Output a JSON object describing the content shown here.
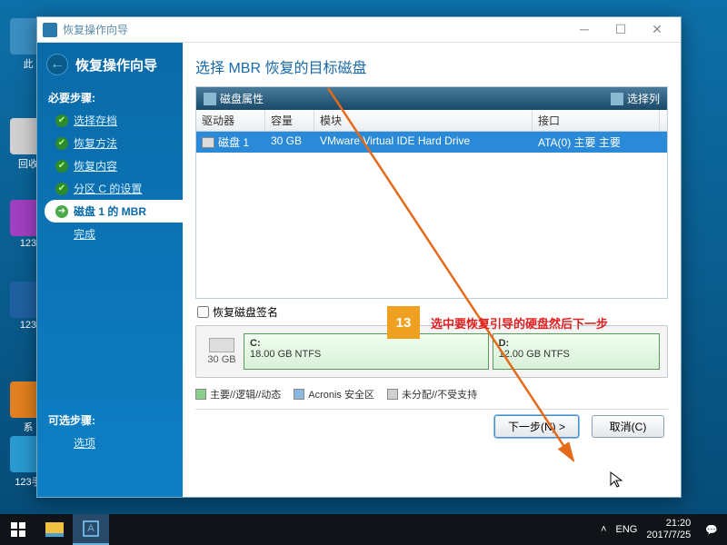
{
  "desktop": {
    "icons": [
      {
        "label": "此"
      },
      {
        "label": "回收"
      },
      {
        "label": "123"
      },
      {
        "label": "123"
      },
      {
        "label": "系"
      },
      {
        "label": "123手"
      }
    ]
  },
  "window": {
    "title": "恢复操作向导",
    "header": "恢复操作向导",
    "sidebar": {
      "required_title": "必要步骤:",
      "optional_title": "可选步骤:",
      "steps": [
        {
          "label": "选择存档",
          "state": "done"
        },
        {
          "label": "恢复方法",
          "state": "done"
        },
        {
          "label": "恢复内容",
          "state": "done"
        },
        {
          "label": "分区 C  的设置",
          "state": "done"
        },
        {
          "label": "磁盘 1 的 MBR",
          "state": "current"
        },
        {
          "label": "完成",
          "state": ""
        }
      ],
      "optional": [
        {
          "label": "选项"
        }
      ]
    },
    "main": {
      "title": "选择 MBR 恢复的目标磁盘",
      "toolbar": {
        "props_label": "磁盘属性",
        "cols_label": "选择列"
      },
      "columns": {
        "drive": "驱动器",
        "capacity": "容量",
        "module": "模块",
        "interface": "接口"
      },
      "row": {
        "drive": "磁盘 1",
        "capacity": "30 GB",
        "module": "VMware Virtual IDE Hard Drive",
        "interface": "ATA(0) 主要 主要"
      },
      "recover_sig_label": "恢复磁盘签名",
      "diskmap": {
        "total": "30 GB",
        "parts": [
          {
            "name": "C:",
            "detail": "18.00 GB  NTFS"
          },
          {
            "name": "D:",
            "detail": "12.00 GB  NTFS"
          }
        ]
      },
      "legend": {
        "primary": "主要//逻辑//动态",
        "acronis": "Acronis 安全区",
        "unalloc": "未分配//不受支持"
      },
      "buttons": {
        "next": "下一步(N) >",
        "cancel": "取消(C)"
      }
    }
  },
  "annotation": {
    "num": "13",
    "text": "选中要恢复引导的硬盘然后下一步"
  },
  "taskbar": {
    "lang": "ENG",
    "time": "21:20",
    "date": "2017/7/25"
  }
}
